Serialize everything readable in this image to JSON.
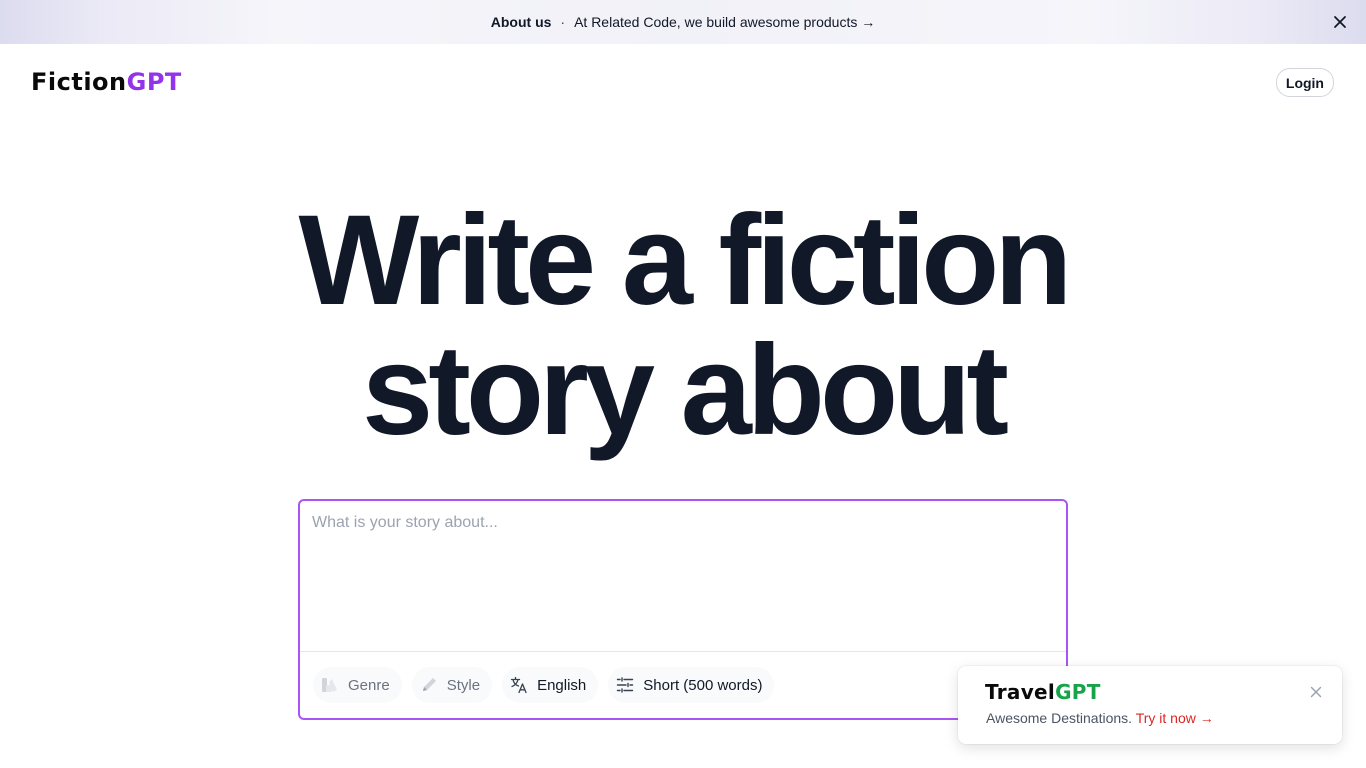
{
  "banner": {
    "title": "About us",
    "separator": "·",
    "text": "At Related Code, we build awesome products →",
    "close_icon": "x-icon"
  },
  "header": {
    "logo_part1": "Fiction",
    "logo_part2": "GPT",
    "login_label": "Login"
  },
  "hero": {
    "line1": "Write a fiction",
    "line2": "story about"
  },
  "composer": {
    "placeholder": "What is your story about...",
    "value": "",
    "genre_label": "Genre",
    "style_label": "Style",
    "language_label": "English",
    "length_label": "Short (500 words)",
    "icons": [
      "genre-icon",
      "pencil-icon",
      "translate-icon",
      "sliders-icon"
    ]
  },
  "toast": {
    "logo_part1": "Travel",
    "logo_part2": "GPT",
    "description": "Awesome Destinations.",
    "link_label": "Try it now →"
  },
  "colors": {
    "accent": "#a855f7",
    "logo_accent": "#9333ea",
    "travel_accent": "#16a34a",
    "link_red": "#dc2626"
  }
}
